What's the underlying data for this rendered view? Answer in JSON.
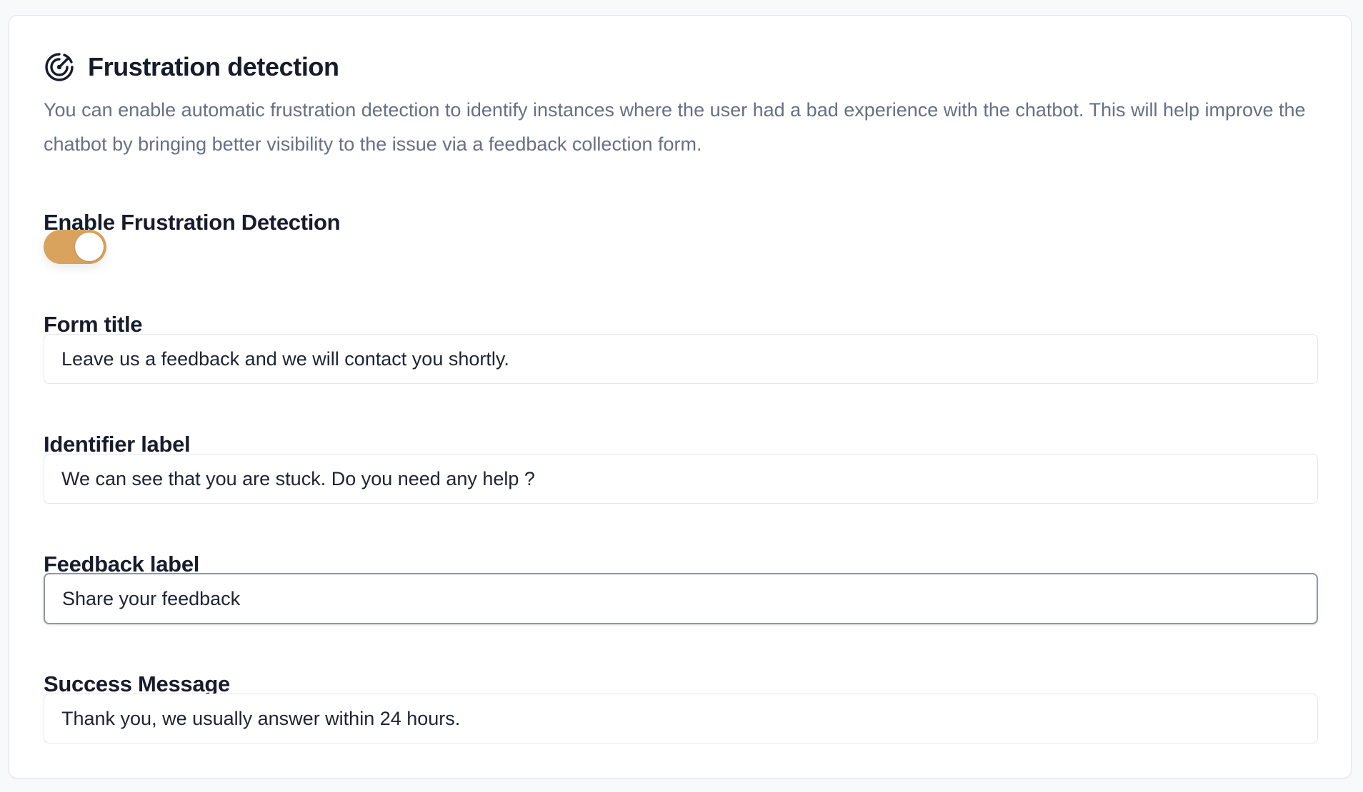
{
  "header": {
    "title": "Frustration detection",
    "icon": "radar-icon",
    "description": "You can enable automatic frustration detection to identify instances where the user had a bad experience with the chatbot. This will help improve the chatbot by bringing better visibility to the issue via a feedback collection form."
  },
  "toggle": {
    "label": "Enable Frustration Detection",
    "enabled": true,
    "on_color": "#d9a25d"
  },
  "fields": {
    "form_title": {
      "label": "Form title",
      "value": "Leave us a feedback and we will contact you shortly."
    },
    "identifier_label": {
      "label": "Identifier label",
      "value": "We can see that you are stuck. Do you need any help ?"
    },
    "feedback_label": {
      "label": "Feedback label",
      "value": "Share your feedback"
    },
    "success_message": {
      "label": "Success Message",
      "value": "Thank you, we usually answer within 24 hours."
    }
  }
}
